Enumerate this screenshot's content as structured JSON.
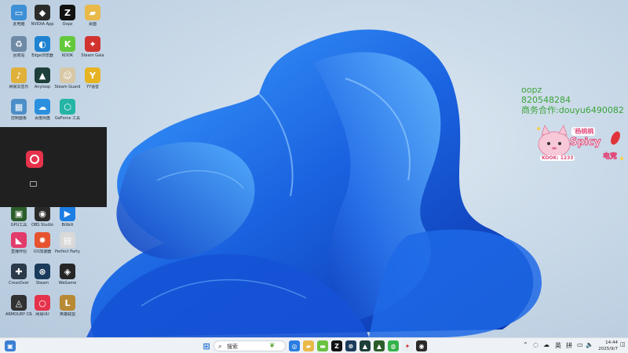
{
  "desktop": {
    "icons": [
      {
        "label": "此电脑",
        "glyph": "▭",
        "color": "#3d8fd6"
      },
      {
        "label": "NVIDIA App",
        "glyph": "◆",
        "color": "#2b2b2b"
      },
      {
        "label": "Oopz",
        "glyph": "Z",
        "color": "#111111"
      },
      {
        "label": "桌面",
        "glyph": "▰",
        "color": "#e9b949"
      },
      {
        "label": "回收站",
        "glyph": "♻",
        "color": "#6f8aa6"
      },
      {
        "label": "Edge浏览器",
        "glyph": "◐",
        "color": "#1f83d1"
      },
      {
        "label": "KOOK",
        "glyph": "K",
        "color": "#63c83b"
      },
      {
        "label": "Steam Gala",
        "glyph": "✦",
        "color": "#d1342f"
      },
      {
        "label": "网易云音乐",
        "glyph": "♪",
        "color": "#e0b13a"
      },
      {
        "label": "Anyloop",
        "glyph": "▲",
        "color": "#1e3f3a"
      },
      {
        "label": "Steam Guard",
        "glyph": "☺",
        "color": "#d8c8a6"
      },
      {
        "label": "YY语音",
        "glyph": "Y",
        "color": "#e6b422"
      },
      {
        "label": "控制面板",
        "glyph": "▦",
        "color": "#4c8fc8"
      },
      {
        "label": "百度网盘",
        "glyph": "☁",
        "color": "#2b8fe0"
      },
      {
        "label": "GeForce 工具",
        "glyph": "⬡",
        "color": "#25b5a6"
      },
      {
        "label": "GPU工具",
        "glyph": "▣",
        "color": "#2b5d2b"
      },
      {
        "label": "OBS Studio",
        "glyph": "◉",
        "color": "#2a2a2a"
      },
      {
        "label": "Bilibili",
        "glyph": "▶",
        "color": "#1c7de3"
      },
      {
        "label": "直播伴侣",
        "glyph": "◣",
        "color": "#e23c6a"
      },
      {
        "label": "UU加速器",
        "glyph": "✸",
        "color": "#e6532f"
      },
      {
        "label": "Perfect Party",
        "glyph": "▤",
        "color": "#d9d9d9"
      },
      {
        "label": "CrossOver",
        "glyph": "✚",
        "color": "#2c3a4a"
      },
      {
        "label": "Steam",
        "glyph": "⊛",
        "color": "#1b3b5c"
      },
      {
        "label": "WeGame",
        "glyph": "◈",
        "color": "#262626"
      },
      {
        "label": "ARMOURY CRATE",
        "glyph": "◬",
        "color": "#323232"
      },
      {
        "label": "网易UU",
        "glyph": "○",
        "color": "#e5334b"
      },
      {
        "label": "英雄联盟",
        "glyph": "L",
        "color": "#b88a34"
      }
    ]
  },
  "overlay": {
    "line1": "oopz",
    "line2": "820548284",
    "line3": "商务合作:douyu6490082",
    "badge_top": "ʹ杨桃桃",
    "badge_main": "Spicy",
    "badge_kook": "KOOK: 1233",
    "badge_cn": "电竞"
  },
  "taskbar": {
    "search_placeholder": "搜索",
    "lang": "英",
    "ime": "拼",
    "time": "14:44",
    "date": "2025/9/7",
    "accent": "#1f6fd1"
  }
}
